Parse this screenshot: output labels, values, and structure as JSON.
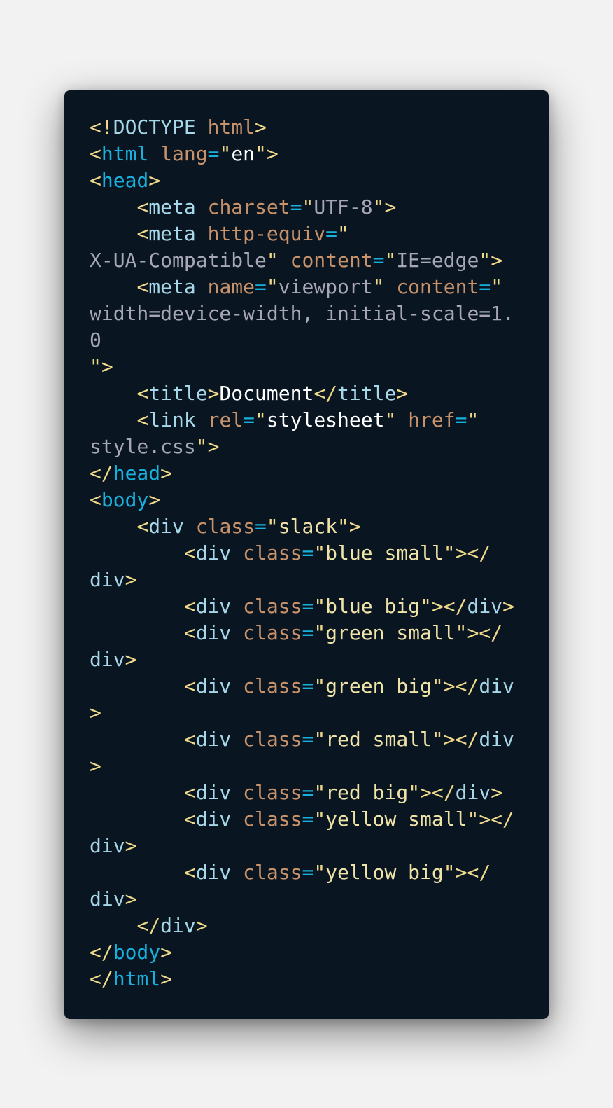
{
  "colors": {
    "background": "#f2f2f2",
    "card": "#091520",
    "punctuation": "#f0d98a",
    "tag": "#a7d8ea",
    "tag_keyword": "#18b0dc",
    "attribute": "#c8926a",
    "equals": "#18b0dc",
    "string": "#a7a7b7",
    "string_light": "#f0e3a8",
    "text": "#ffffff"
  },
  "code": {
    "lines": [
      [
        {
          "t": "punct",
          "v": "<!"
        },
        {
          "t": "tag",
          "v": "DOCTYPE "
        },
        {
          "t": "attr",
          "v": "html"
        },
        {
          "t": "punct",
          "v": ">"
        }
      ],
      [
        {
          "t": "punct",
          "v": "<"
        },
        {
          "t": "tagkw",
          "v": "html"
        },
        {
          "t": "tag",
          "v": " "
        },
        {
          "t": "attr",
          "v": "lang"
        },
        {
          "t": "eq",
          "v": "="
        },
        {
          "t": "punct",
          "v": "\""
        },
        {
          "t": "text",
          "v": "en"
        },
        {
          "t": "punct",
          "v": "\">"
        }
      ],
      [
        {
          "t": "punct",
          "v": "<"
        },
        {
          "t": "tagkw",
          "v": "head"
        },
        {
          "t": "punct",
          "v": ">"
        }
      ],
      [
        {
          "t": "tag",
          "v": "    "
        },
        {
          "t": "punct",
          "v": "<"
        },
        {
          "t": "tag",
          "v": "meta "
        },
        {
          "t": "attr",
          "v": "charset"
        },
        {
          "t": "eq",
          "v": "="
        },
        {
          "t": "punct",
          "v": "\""
        },
        {
          "t": "str",
          "v": "UTF-8"
        },
        {
          "t": "punct",
          "v": "\">"
        }
      ],
      [
        {
          "t": "tag",
          "v": "    "
        },
        {
          "t": "punct",
          "v": "<"
        },
        {
          "t": "tag",
          "v": "meta "
        },
        {
          "t": "attr",
          "v": "http-equiv"
        },
        {
          "t": "eq",
          "v": "="
        },
        {
          "t": "punct",
          "v": "\""
        }
      ],
      [
        {
          "t": "str",
          "v": "X-UA-Compatible"
        },
        {
          "t": "punct",
          "v": "\" "
        },
        {
          "t": "attr",
          "v": "content"
        },
        {
          "t": "eq",
          "v": "="
        },
        {
          "t": "punct",
          "v": "\""
        },
        {
          "t": "str",
          "v": "IE=edge"
        },
        {
          "t": "punct",
          "v": "\">"
        }
      ],
      [
        {
          "t": "tag",
          "v": "    "
        },
        {
          "t": "punct",
          "v": "<"
        },
        {
          "t": "tag",
          "v": "meta "
        },
        {
          "t": "attr",
          "v": "name"
        },
        {
          "t": "eq",
          "v": "="
        },
        {
          "t": "punct",
          "v": "\""
        },
        {
          "t": "str",
          "v": "viewport"
        },
        {
          "t": "punct",
          "v": "\" "
        },
        {
          "t": "attr",
          "v": "content"
        },
        {
          "t": "eq",
          "v": "="
        },
        {
          "t": "punct",
          "v": "\""
        }
      ],
      [
        {
          "t": "str",
          "v": "width=device-width, initial-scale=1."
        }
      ],
      [
        {
          "t": "str",
          "v": "0"
        }
      ],
      [
        {
          "t": "punct",
          "v": "\">"
        }
      ],
      [
        {
          "t": "tag",
          "v": "    "
        },
        {
          "t": "punct",
          "v": "<"
        },
        {
          "t": "tag",
          "v": "title"
        },
        {
          "t": "punct",
          "v": ">"
        },
        {
          "t": "text",
          "v": "Document"
        },
        {
          "t": "punct",
          "v": "</"
        },
        {
          "t": "tag",
          "v": "title"
        },
        {
          "t": "punct",
          "v": ">"
        }
      ],
      [
        {
          "t": "tag",
          "v": "    "
        },
        {
          "t": "punct",
          "v": "<"
        },
        {
          "t": "tag",
          "v": "link "
        },
        {
          "t": "attr",
          "v": "rel"
        },
        {
          "t": "eq",
          "v": "="
        },
        {
          "t": "punct",
          "v": "\""
        },
        {
          "t": "text",
          "v": "stylesheet"
        },
        {
          "t": "punct",
          "v": "\" "
        },
        {
          "t": "attr",
          "v": "href"
        },
        {
          "t": "eq",
          "v": "="
        },
        {
          "t": "punct",
          "v": "\""
        }
      ],
      [
        {
          "t": "str",
          "v": "style.css"
        },
        {
          "t": "punct",
          "v": "\">"
        }
      ],
      [
        {
          "t": "punct",
          "v": "</"
        },
        {
          "t": "tagkw",
          "v": "head"
        },
        {
          "t": "punct",
          "v": ">"
        }
      ],
      [
        {
          "t": "punct",
          "v": "<"
        },
        {
          "t": "tagkw",
          "v": "body"
        },
        {
          "t": "punct",
          "v": ">"
        }
      ],
      [
        {
          "t": "tag",
          "v": "    "
        },
        {
          "t": "punct",
          "v": "<"
        },
        {
          "t": "tag",
          "v": "div "
        },
        {
          "t": "attr",
          "v": "class"
        },
        {
          "t": "eq",
          "v": "="
        },
        {
          "t": "punct",
          "v": "\""
        },
        {
          "t": "strl",
          "v": "slack"
        },
        {
          "t": "punct",
          "v": "\">"
        }
      ],
      [
        {
          "t": "tag",
          "v": "        "
        },
        {
          "t": "punct",
          "v": "<"
        },
        {
          "t": "tag",
          "v": "div "
        },
        {
          "t": "attr",
          "v": "class"
        },
        {
          "t": "eq",
          "v": "="
        },
        {
          "t": "punct",
          "v": "\""
        },
        {
          "t": "strl",
          "v": "blue small"
        },
        {
          "t": "punct",
          "v": "\"></"
        }
      ],
      [
        {
          "t": "tag",
          "v": "div"
        },
        {
          "t": "punct",
          "v": ">"
        }
      ],
      [
        {
          "t": "tag",
          "v": "        "
        },
        {
          "t": "punct",
          "v": "<"
        },
        {
          "t": "tag",
          "v": "div "
        },
        {
          "t": "attr",
          "v": "class"
        },
        {
          "t": "eq",
          "v": "="
        },
        {
          "t": "punct",
          "v": "\""
        },
        {
          "t": "strl",
          "v": "blue big"
        },
        {
          "t": "punct",
          "v": "\"></"
        },
        {
          "t": "tag",
          "v": "div"
        },
        {
          "t": "punct",
          "v": ">"
        }
      ],
      [
        {
          "t": "tag",
          "v": "        "
        },
        {
          "t": "punct",
          "v": "<"
        },
        {
          "t": "tag",
          "v": "div "
        },
        {
          "t": "attr",
          "v": "class"
        },
        {
          "t": "eq",
          "v": "="
        },
        {
          "t": "punct",
          "v": "\""
        },
        {
          "t": "strl",
          "v": "green small"
        },
        {
          "t": "punct",
          "v": "\"></"
        }
      ],
      [
        {
          "t": "tag",
          "v": "div"
        },
        {
          "t": "punct",
          "v": ">"
        }
      ],
      [
        {
          "t": "tag",
          "v": "        "
        },
        {
          "t": "punct",
          "v": "<"
        },
        {
          "t": "tag",
          "v": "div "
        },
        {
          "t": "attr",
          "v": "class"
        },
        {
          "t": "eq",
          "v": "="
        },
        {
          "t": "punct",
          "v": "\""
        },
        {
          "t": "strl",
          "v": "green big"
        },
        {
          "t": "punct",
          "v": "\"></"
        },
        {
          "t": "tag",
          "v": "div"
        }
      ],
      [
        {
          "t": "punct",
          "v": ">"
        }
      ],
      [
        {
          "t": "tag",
          "v": "        "
        },
        {
          "t": "punct",
          "v": "<"
        },
        {
          "t": "tag",
          "v": "div "
        },
        {
          "t": "attr",
          "v": "class"
        },
        {
          "t": "eq",
          "v": "="
        },
        {
          "t": "punct",
          "v": "\""
        },
        {
          "t": "strl",
          "v": "red small"
        },
        {
          "t": "punct",
          "v": "\"></"
        },
        {
          "t": "tag",
          "v": "div"
        }
      ],
      [
        {
          "t": "punct",
          "v": ">"
        }
      ],
      [
        {
          "t": "tag",
          "v": "        "
        },
        {
          "t": "punct",
          "v": "<"
        },
        {
          "t": "tag",
          "v": "div "
        },
        {
          "t": "attr",
          "v": "class"
        },
        {
          "t": "eq",
          "v": "="
        },
        {
          "t": "punct",
          "v": "\""
        },
        {
          "t": "strl",
          "v": "red big"
        },
        {
          "t": "punct",
          "v": "\"></"
        },
        {
          "t": "tag",
          "v": "div"
        },
        {
          "t": "punct",
          "v": ">"
        }
      ],
      [
        {
          "t": "tag",
          "v": "        "
        },
        {
          "t": "punct",
          "v": "<"
        },
        {
          "t": "tag",
          "v": "div "
        },
        {
          "t": "attr",
          "v": "class"
        },
        {
          "t": "eq",
          "v": "="
        },
        {
          "t": "punct",
          "v": "\""
        },
        {
          "t": "strl",
          "v": "yellow small"
        },
        {
          "t": "punct",
          "v": "\"></"
        }
      ],
      [
        {
          "t": "tag",
          "v": "div"
        },
        {
          "t": "punct",
          "v": ">"
        }
      ],
      [
        {
          "t": "tag",
          "v": "        "
        },
        {
          "t": "punct",
          "v": "<"
        },
        {
          "t": "tag",
          "v": "div "
        },
        {
          "t": "attr",
          "v": "class"
        },
        {
          "t": "eq",
          "v": "="
        },
        {
          "t": "punct",
          "v": "\""
        },
        {
          "t": "strl",
          "v": "yellow big"
        },
        {
          "t": "punct",
          "v": "\"></"
        }
      ],
      [
        {
          "t": "tag",
          "v": "div"
        },
        {
          "t": "punct",
          "v": ">"
        }
      ],
      [
        {
          "t": "tag",
          "v": "    "
        },
        {
          "t": "punct",
          "v": "</"
        },
        {
          "t": "tag",
          "v": "div"
        },
        {
          "t": "punct",
          "v": ">"
        }
      ],
      [
        {
          "t": "punct",
          "v": "</"
        },
        {
          "t": "tagkw",
          "v": "body"
        },
        {
          "t": "punct",
          "v": ">"
        }
      ],
      [
        {
          "t": "punct",
          "v": "</"
        },
        {
          "t": "tagkw",
          "v": "html"
        },
        {
          "t": "punct",
          "v": ">"
        }
      ]
    ]
  }
}
